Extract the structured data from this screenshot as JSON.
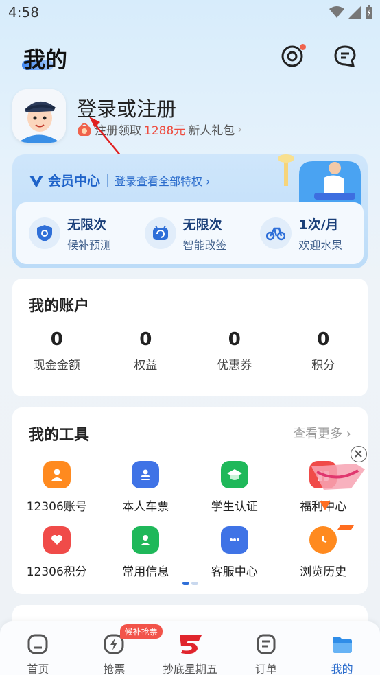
{
  "status_bar": {
    "time": "4:58"
  },
  "header": {
    "title": "我的"
  },
  "profile": {
    "login_title": "登录或注册",
    "subtitle_prefix": "注册领取",
    "subtitle_amount": "1288元",
    "subtitle_suffix": "新人礼包",
    "chevron": "›"
  },
  "member": {
    "title": "会员中心",
    "link": "登录查看全部特权 ›",
    "perks": [
      {
        "main": "无限次",
        "sub": "候补预测",
        "icon": "shield-icon"
      },
      {
        "main": "无限次",
        "sub": "智能改签",
        "icon": "swap-icon"
      },
      {
        "main": "1次/月",
        "sub": "欢迎水果",
        "icon": "bicycle-icon"
      }
    ]
  },
  "account": {
    "title": "我的账户",
    "items": [
      {
        "value": "0",
        "label": "现金金额"
      },
      {
        "value": "0",
        "label": "权益"
      },
      {
        "value": "0",
        "label": "优惠券"
      },
      {
        "value": "0",
        "label": "积分"
      }
    ]
  },
  "tools": {
    "title": "我的工具",
    "more": "查看更多 ›",
    "items": [
      {
        "label": "12306账号",
        "icon": "account-icon",
        "color": "#ff8a1f"
      },
      {
        "label": "本人车票",
        "icon": "ticket-icon",
        "color": "#3f73e6"
      },
      {
        "label": "学生认证",
        "icon": "graduation-cap-icon",
        "color": "#1fb85a"
      },
      {
        "label": "福利中心",
        "icon": "gift-icon",
        "color": "#f04b49"
      },
      {
        "label": "12306积分",
        "icon": "points-icon",
        "color": "#f04b49"
      },
      {
        "label": "常用信息",
        "icon": "contact-icon",
        "color": "#1fb85a"
      },
      {
        "label": "客服中心",
        "icon": "chat-icon",
        "color": "#3f73e6"
      },
      {
        "label": "浏览历史",
        "icon": "clock-icon",
        "color": "#ff8a1f"
      }
    ]
  },
  "tabbar": {
    "badge": "候补抢票",
    "tabs": [
      {
        "label": "首页"
      },
      {
        "label": "抢票"
      },
      {
        "label": "抄底星期五"
      },
      {
        "label": "订单"
      },
      {
        "label": "我的"
      }
    ]
  }
}
